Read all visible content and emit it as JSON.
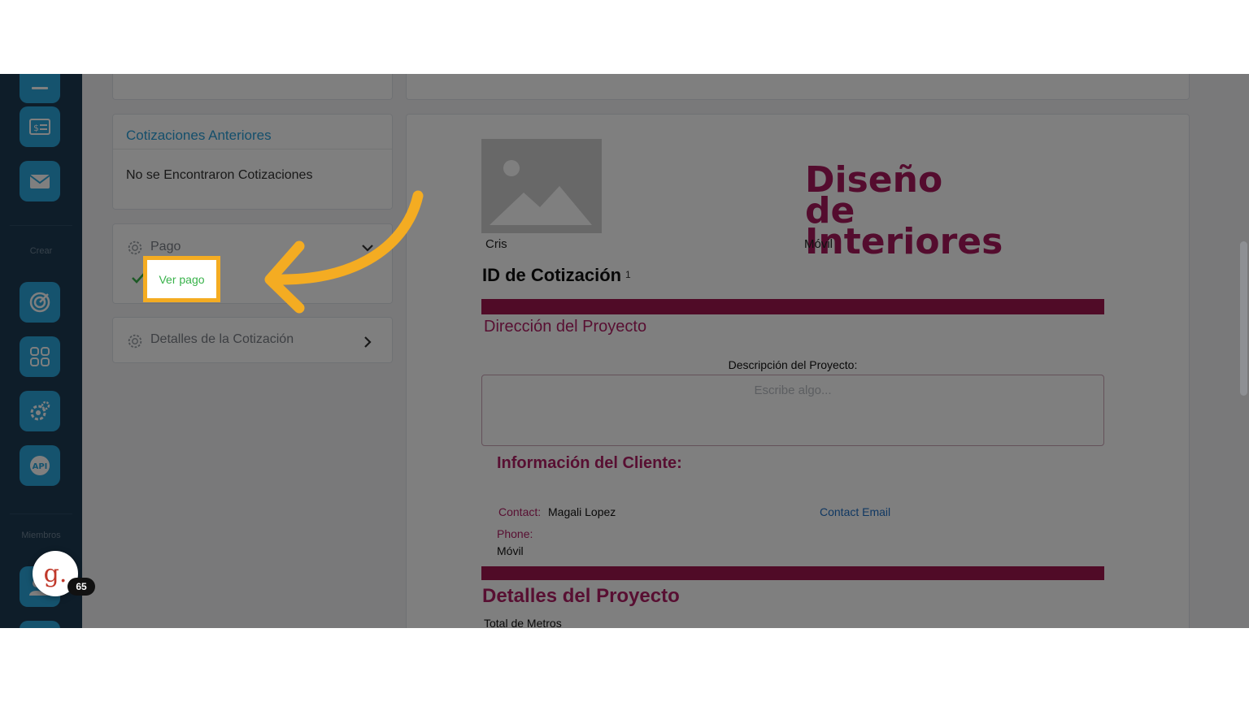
{
  "sidebar": {
    "section_create": "Crear",
    "section_members": "Miembros",
    "icons": [
      "list-icon",
      "invoice-icon",
      "mail-icon",
      "target-icon",
      "grid-icon",
      "settings-icon",
      "api-icon",
      "members-icon"
    ],
    "api_label": "API",
    "invoice_glyph": "$",
    "accent_color": "#2aa6dc",
    "background_color": "#1d3a53"
  },
  "user": {
    "avatar_letter": "g.",
    "notification_count": "65"
  },
  "left_panel": {
    "previous_quotes_title": "Cotizaciones Anteriores",
    "previous_quotes_empty": "No se Encontraron Cotizaciones",
    "payment_title": "Pago",
    "view_payment_link": "Ver pago",
    "quote_details_title": "Detalles de la Cotización"
  },
  "quote": {
    "company_name": "Cris",
    "logo_text_line1": "Diseño de",
    "logo_text_line2": "Interiores",
    "phone_label_top": "Móvil",
    "quote_id_label": "ID de Cotización",
    "quote_id_value": "1",
    "project_address_title": "Dirección del Proyecto",
    "project_description_label": "Descripción del Proyecto:",
    "project_description_placeholder": "Escribe algo...",
    "client_info_title": "Información del Cliente:",
    "contact_label": "Contact:",
    "contact_name": "Magali Lopez",
    "contact_email_label": "Contact Email",
    "phone_label": "Phone:",
    "phone_value": "Móvil",
    "project_details_title": "Detalles del Proyecto",
    "total_meters_label": "Total de Metros",
    "brand_color": "#a1164f"
  },
  "highlight": {
    "color": "#f4ac22"
  }
}
